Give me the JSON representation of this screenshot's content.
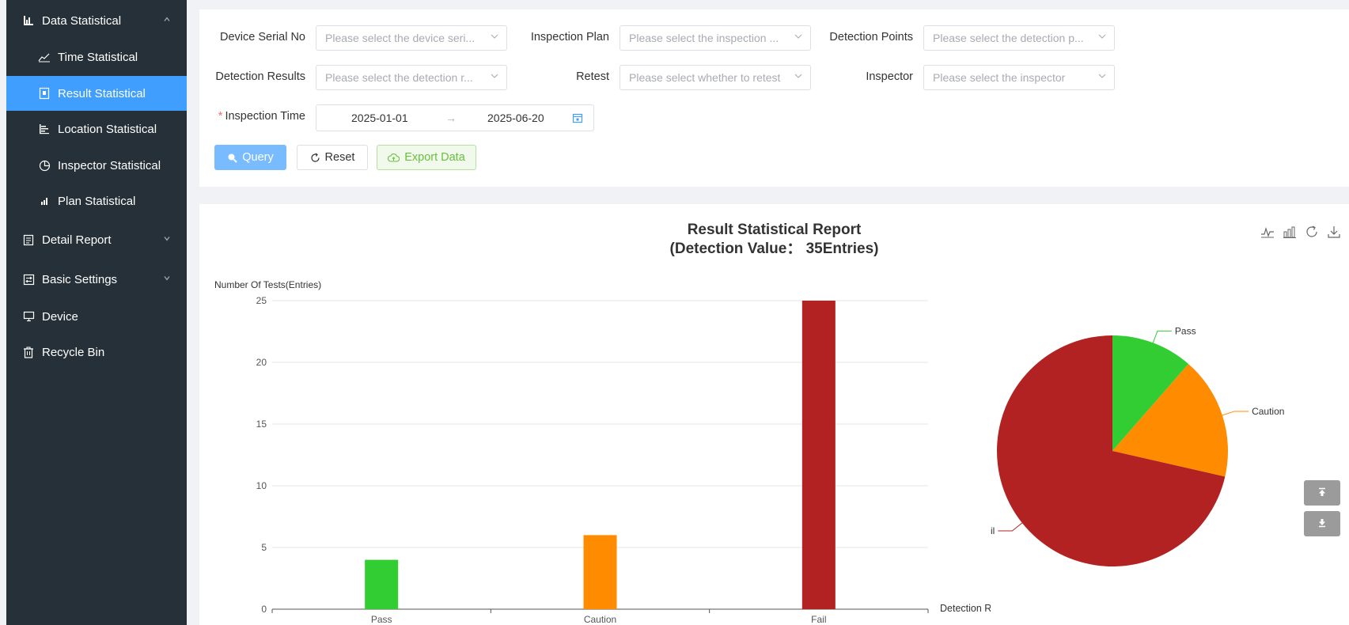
{
  "sidebar": {
    "items": [
      {
        "label": "Data Statistical",
        "icon": "bar-chart-icon",
        "arrow": "^"
      },
      {
        "label": "Time Statistical",
        "icon": "line-chart-icon"
      },
      {
        "label": "Result Statistical",
        "icon": "result-doc-icon"
      },
      {
        "label": "Location Statistical",
        "icon": "location-bars-icon"
      },
      {
        "label": "Inspector Statistical",
        "icon": "pie-chart-icon"
      },
      {
        "label": "Plan Statistical",
        "icon": "plan-chart-icon"
      },
      {
        "label": "Detail Report",
        "icon": "report-icon",
        "arrow": "v"
      },
      {
        "label": "Basic Settings",
        "icon": "settings-icon",
        "arrow": "v"
      },
      {
        "label": "Device",
        "icon": "device-icon"
      },
      {
        "label": "Recycle Bin",
        "icon": "recycle-bin-icon"
      }
    ]
  },
  "filters": {
    "device_serial_label": "Device Serial No",
    "device_serial_placeholder": "Please select the device seri...",
    "inspection_plan_label": "Inspection Plan",
    "inspection_plan_placeholder": "Please select the inspection ...",
    "detection_points_label": "Detection Points",
    "detection_points_placeholder": "Please select the detection p...",
    "detection_results_label": "Detection Results",
    "detection_results_placeholder": "Please select the detection r...",
    "retest_label": "Retest",
    "retest_placeholder": "Please select whether to retest",
    "inspector_label": "Inspector",
    "inspector_placeholder": "Please select the inspector",
    "inspection_time_required": "*",
    "inspection_time_label": "Inspection Time",
    "start_date": "2025-01-01",
    "range_separator": "→",
    "end_date": "2025-06-20"
  },
  "buttons": {
    "query": "Query",
    "reset": "Reset",
    "export": "Export Data"
  },
  "chart_data": [
    {
      "type": "bar",
      "title": "Result Statistical Report",
      "subtitle": "(Detection Value： 35Entries)",
      "ylabel": "Number Of Tests(Entries)",
      "xlabel": "Detection Results",
      "categories": [
        "Pass",
        "Caution",
        "Fail"
      ],
      "values": [
        4,
        6,
        25
      ],
      "colors": [
        "#32cd32",
        "#ff8c00",
        "#b22222"
      ],
      "ylim": [
        0,
        25
      ],
      "yticks": [
        0,
        5,
        10,
        15,
        20,
        25
      ],
      "grid": true
    },
    {
      "type": "pie",
      "categories": [
        "Pass",
        "Caution",
        "Fail"
      ],
      "values": [
        4,
        6,
        25
      ],
      "colors": [
        "#32cd32",
        "#ff8c00",
        "#b22222"
      ]
    }
  ]
}
